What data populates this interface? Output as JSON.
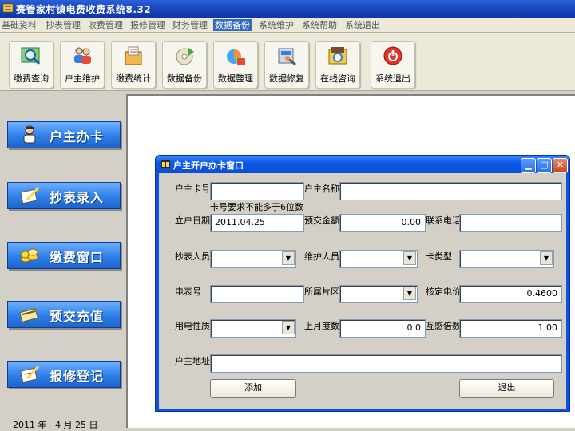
{
  "window": {
    "title": "赛管家村镇电费收费系统8.32"
  },
  "menu": [
    {
      "label": "基础资料"
    },
    {
      "label": "抄表管理"
    },
    {
      "label": "收费管理"
    },
    {
      "label": "报修管理"
    },
    {
      "label": "财务管理"
    },
    {
      "label": "数据备份",
      "active": true
    },
    {
      "label": "系统维护"
    },
    {
      "label": "系统帮助"
    },
    {
      "label": "系统退出"
    }
  ],
  "toolbar": [
    {
      "label": "缴费查询",
      "icon": "magnifier-icon"
    },
    {
      "label": "户主维护",
      "icon": "users-icon"
    },
    {
      "label": "缴费统计",
      "icon": "statistics-icon"
    },
    {
      "label": "数据备份",
      "icon": "backup-disc-icon"
    },
    {
      "label": "数据整理",
      "icon": "organize-icon"
    },
    {
      "label": "数据修复",
      "icon": "repair-icon"
    },
    {
      "label": "在线咨询",
      "icon": "online-help-icon"
    },
    {
      "label": "系统退出",
      "icon": "power-icon"
    }
  ],
  "sidebar": [
    {
      "label": "户主办卡",
      "icon": "person-icon"
    },
    {
      "label": "抄表录入",
      "icon": "notepad-icon"
    },
    {
      "label": "缴费窗口",
      "icon": "coins-icon"
    },
    {
      "label": "预交充值",
      "icon": "card-icon"
    },
    {
      "label": "报修登记",
      "icon": "repair-note-icon"
    }
  ],
  "status": {
    "year": "2011",
    "year_unit": "年",
    "month": "4",
    "month_unit": "月",
    "day": "25",
    "day_unit": "日"
  },
  "dialog": {
    "title": "户主开户办卡窗口",
    "fields": {
      "card_no": {
        "label": "户主卡号",
        "value": "",
        "hint": "卡号要求不能多于6位数"
      },
      "owner_name": {
        "label": "户主名称",
        "value": ""
      },
      "open_date": {
        "label": "立户日期",
        "value": "2011.04.25"
      },
      "prepaid": {
        "label": "预交金额",
        "value": "0.00"
      },
      "phone": {
        "label": "联系电话",
        "value": ""
      },
      "reader": {
        "label": "抄表人员",
        "value": ""
      },
      "maintainer": {
        "label": "维护人员",
        "value": ""
      },
      "card_type": {
        "label": "卡类型",
        "value": ""
      },
      "meter_no": {
        "label": "电表号",
        "value": ""
      },
      "district": {
        "label": "所属片区",
        "value": ""
      },
      "price": {
        "label": "核定电价",
        "value": "0.4600"
      },
      "usage_type": {
        "label": "用电性质",
        "value": ""
      },
      "last_reading": {
        "label": "上月度数",
        "value": "0.0"
      },
      "multiplier": {
        "label": "互感倍数",
        "value": "1.00"
      },
      "address": {
        "label": "户主地址",
        "value": ""
      }
    },
    "buttons": {
      "add": "添加",
      "exit": "退出"
    }
  },
  "colors": {
    "accent": "#316ac5",
    "sidebar_button": "#2e7fe8",
    "dialog_frame": "#0b54e3"
  }
}
